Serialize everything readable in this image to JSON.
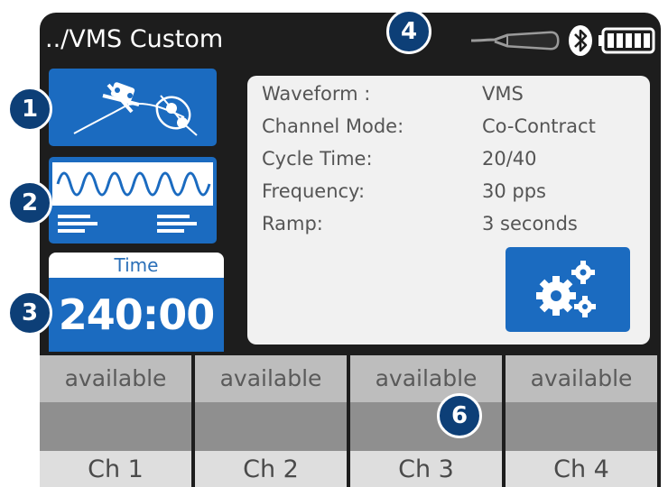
{
  "header": {
    "title": "../VMS Custom"
  },
  "status_icons": [
    "cable-connector-icon",
    "bluetooth-icon",
    "battery-full-icon"
  ],
  "time": {
    "label": "Time",
    "value": "240:00"
  },
  "settings": [
    {
      "key": "Waveform :",
      "value": "VMS"
    },
    {
      "key": "Channel Mode:",
      "value": "Co-Contract"
    },
    {
      "key": "Cycle Time:",
      "value": "20/40"
    },
    {
      "key": "Frequency:",
      "value": "30 pps"
    },
    {
      "key": "Ramp:",
      "value": "3 seconds"
    }
  ],
  "channels": [
    {
      "status": "available",
      "name": "Ch 1"
    },
    {
      "status": "available",
      "name": "Ch 2"
    },
    {
      "status": "available",
      "name": "Ch 3"
    },
    {
      "status": "available",
      "name": "Ch 4"
    }
  ],
  "callouts": [
    "1",
    "2",
    "3",
    "4",
    "6"
  ],
  "colors": {
    "accent_blue": "#1b6bc0",
    "callout_navy": "#0d3f77",
    "screen_bg": "#1d1d1d",
    "panel_bg": "#f1f1f1"
  }
}
